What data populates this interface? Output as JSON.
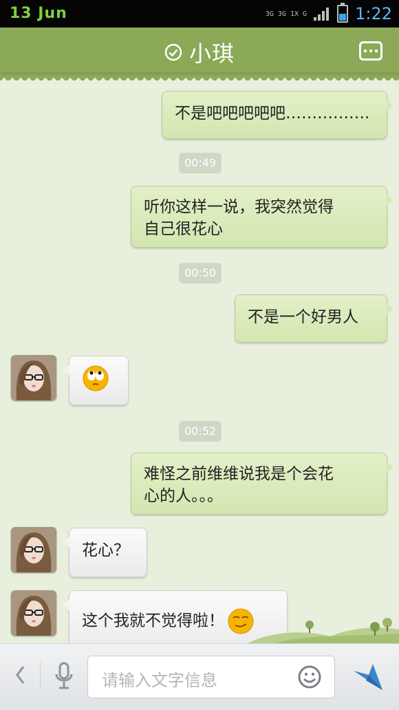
{
  "status_bar": {
    "date": "13 Jun",
    "network_1": "3G 3G 1X G",
    "time": "1:22"
  },
  "header": {
    "title": "小琪"
  },
  "messages": [
    {
      "side": "right",
      "text": "不是吧吧吧吧吧……………."
    },
    {
      "type": "time",
      "text": "00:49"
    },
    {
      "side": "right",
      "line1": "听你这样一说，我突然觉得",
      "line2": "自己很花心"
    },
    {
      "type": "time",
      "text": "00:50"
    },
    {
      "side": "right",
      "text": "不是一个好男人"
    },
    {
      "side": "left",
      "emoji": "rolling-eyes-emoji"
    },
    {
      "type": "time",
      "text": "00:52"
    },
    {
      "side": "right",
      "line1": "难怪之前维维说我是个会花",
      "line2": "心的人。。。"
    },
    {
      "side": "left",
      "text": "花心？"
    },
    {
      "side": "left",
      "text": "这个我就不觉得啦！",
      "emoji": "smirk-emoji"
    }
  ],
  "input_bar": {
    "placeholder": "请输入文字信息"
  }
}
